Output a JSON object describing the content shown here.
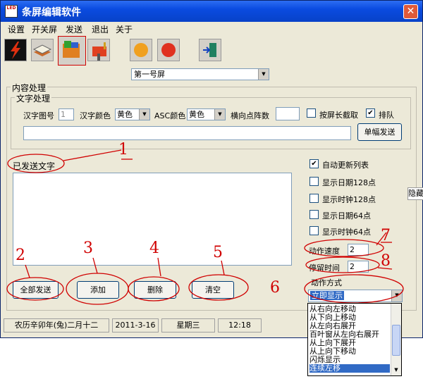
{
  "window": {
    "title": "条屏编辑软件",
    "app_icon_text": "LED"
  },
  "menu": [
    "设置",
    "开关屏",
    "发送",
    "退出",
    "关于"
  ],
  "screen_select": {
    "value": "第一号屏"
  },
  "content_group": {
    "title": "内容处理"
  },
  "text_group": {
    "title": "文字处理",
    "hanzi_font_label": "汉字图号",
    "hanzi_font_value": "1",
    "hanzi_color_label": "汉字颜色",
    "hanzi_color_value": "黄色",
    "asc_color_label": "ASC颜色",
    "asc_color_value": "黄色",
    "horizontal_dots_label": "横向点阵数",
    "horizontal_dots_value": "",
    "crop_by_length_label": "按屏长截取",
    "queue_label": "排队",
    "single_send_button": "单幅发送",
    "text_input_value": ""
  },
  "sent_text_label": "已发送文字",
  "options": {
    "auto_update": "自动更新列表",
    "show_date_128": "显示日期128点",
    "show_clock_128": "显示时钟128点",
    "show_date_64": "显示日期64点",
    "show_clock_64": "显示时钟64点",
    "speed_label": "动作速度",
    "speed_value": "2",
    "stay_label": "停留时间",
    "stay_value": "2",
    "mode_label": "动作方式",
    "mode_value": "立即显示",
    "mode_options": [
      "从右向左移动",
      "从下向上移动",
      "从左向右展开",
      "百叶窗从左向右展开",
      "从上向下展开",
      "从上向下移动",
      "闪烁显示",
      "连续左移"
    ]
  },
  "buttons": {
    "send_all": "全部发送",
    "add": "添加",
    "delete": "删除",
    "clear": "清空"
  },
  "annotations": [
    "1",
    "2",
    "3",
    "4",
    "5",
    "6",
    "7",
    "8"
  ],
  "status": {
    "lunar": "农历辛卯年(兔)二月十二",
    "date": "2011-3-16",
    "weekday": "星期三",
    "time": "12:18"
  },
  "side_tab": {
    "label": "隐藏"
  },
  "colors": {
    "titlebar": "#0a4be0",
    "window_bg": "#ece9d8",
    "annotation_red": "#d00000",
    "selection_blue": "#316ac5"
  }
}
